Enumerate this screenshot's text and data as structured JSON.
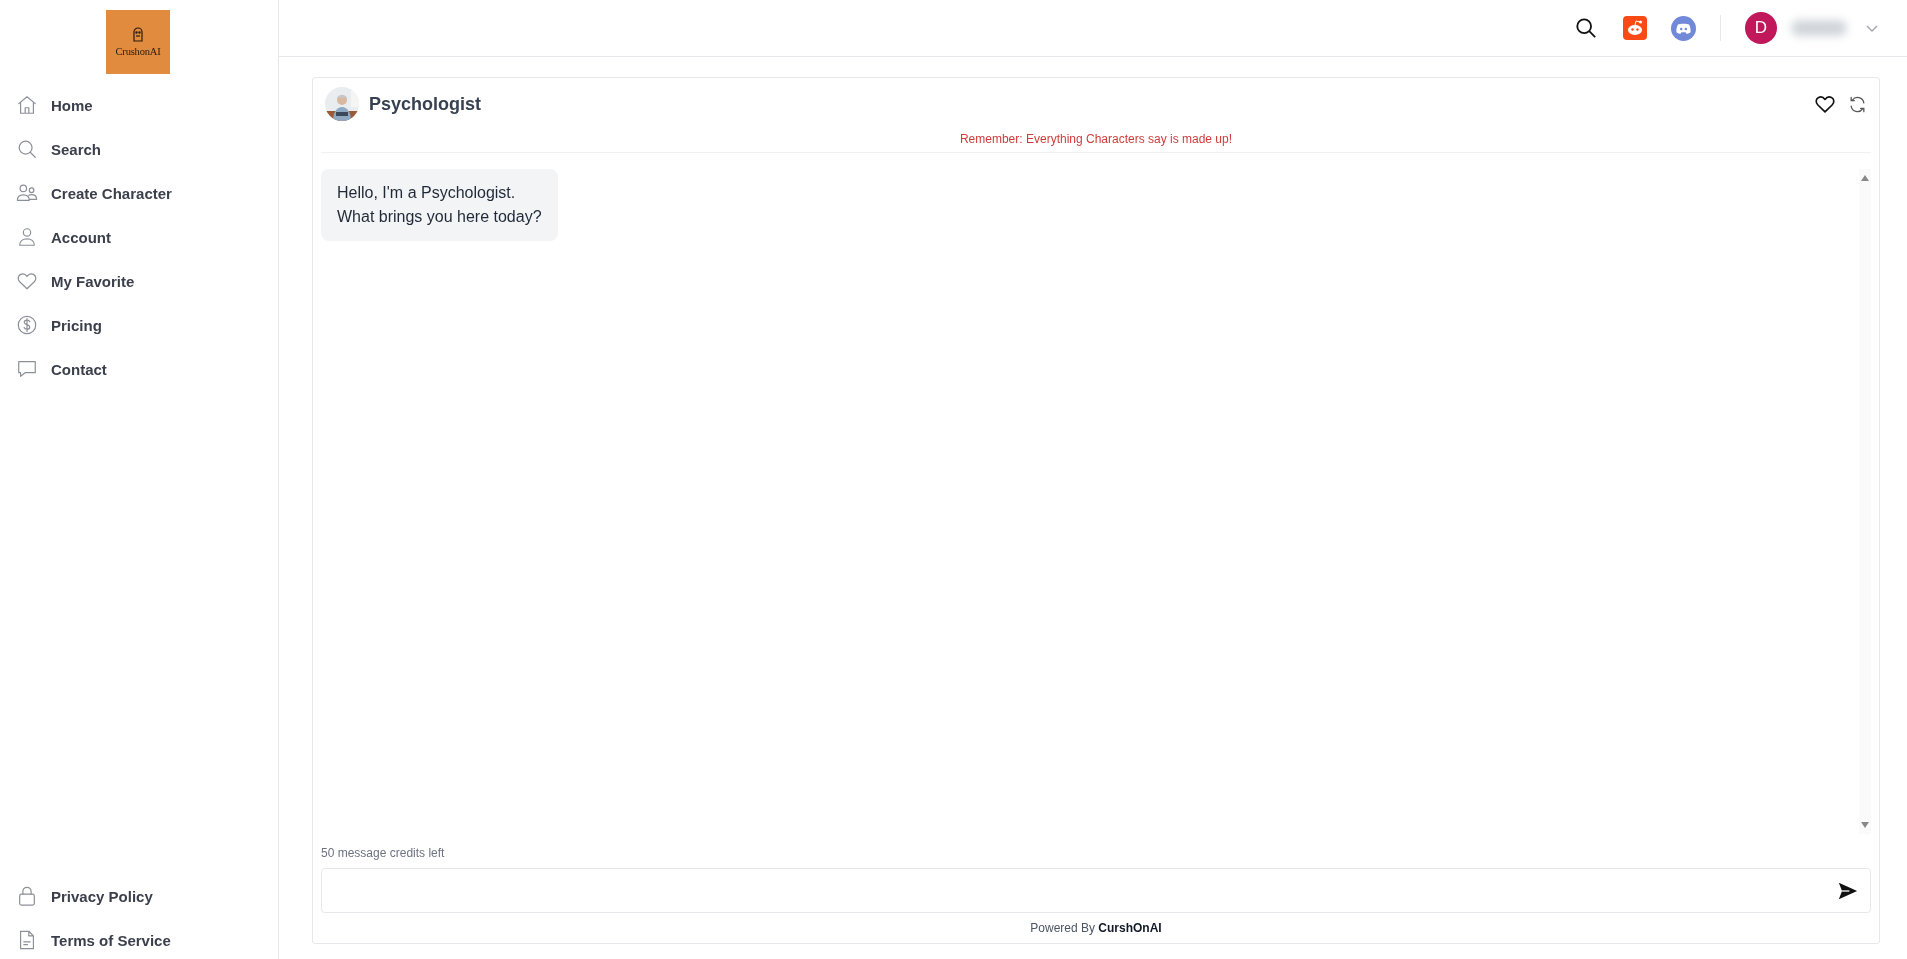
{
  "logo": {
    "text": "CrushonAI"
  },
  "sidebar": {
    "items": [
      {
        "label": "Home",
        "kind": "home"
      },
      {
        "label": "Search",
        "kind": "search"
      },
      {
        "label": "Create Character",
        "kind": "users"
      },
      {
        "label": "Account",
        "kind": "user"
      },
      {
        "label": "My Favorite",
        "kind": "heart"
      },
      {
        "label": "Pricing",
        "kind": "dollar"
      },
      {
        "label": "Contact",
        "kind": "chat"
      }
    ],
    "footer_items": [
      {
        "label": "Privacy Policy",
        "kind": "lock"
      },
      {
        "label": "Terms of Service",
        "kind": "document"
      }
    ]
  },
  "header": {
    "user": {
      "initial": "D"
    }
  },
  "chat": {
    "character": {
      "name": "Psychologist"
    },
    "disclaimer": "Remember: Everything Characters say is made up!",
    "messages": [
      {
        "text": "Hello, I'm a Psychologist.\nWhat brings you here today?"
      }
    ],
    "credits": "50 message credits left",
    "powered_by": "Powered By **CurshOnAI**"
  }
}
